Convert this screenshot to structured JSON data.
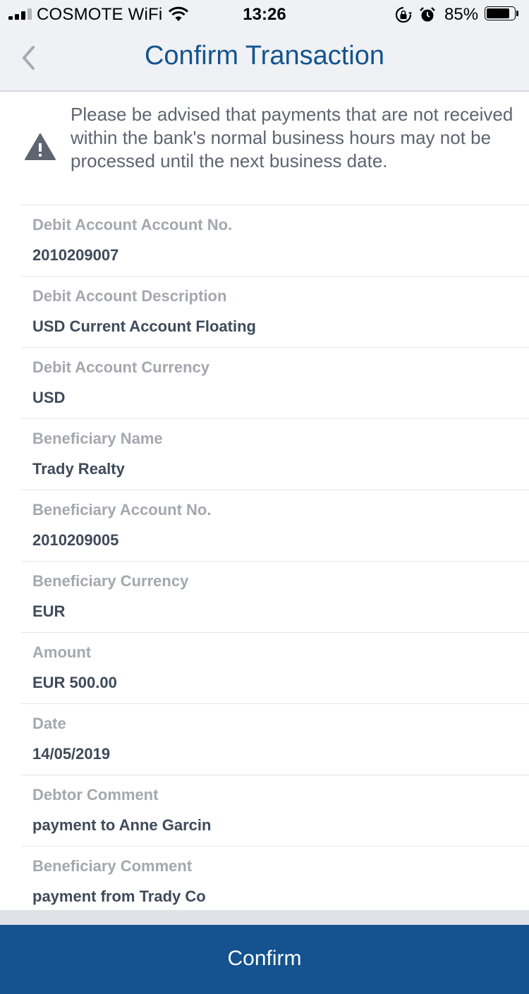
{
  "status_bar": {
    "carrier": "COSMOTE WiFi",
    "time": "13:26",
    "battery": "85%",
    "battery_level": 0.85,
    "signal_bars_active": 3,
    "signal_bars_total": 4,
    "icons": [
      "wifi-icon",
      "rotation-lock-icon",
      "alarm-icon",
      "battery-icon"
    ]
  },
  "header": {
    "title": "Confirm Transaction",
    "back_icon": "chevron-left-icon"
  },
  "notice": {
    "icon": "warning-icon",
    "text": "Please be advised that payments that are not received within the bank's normal business hours may not be processed until the next business date."
  },
  "details": [
    {
      "label": "Debit Account Account No.",
      "value": "2010209007"
    },
    {
      "label": "Debit Account Description",
      "value": "USD Current Account Floating"
    },
    {
      "label": "Debit Account Currency",
      "value": "USD"
    },
    {
      "label": "Beneficiary Name",
      "value": "Trady Realty"
    },
    {
      "label": "Beneficiary Account No.",
      "value": "2010209005"
    },
    {
      "label": "Beneficiary Currency",
      "value": "EUR"
    },
    {
      "label": "Amount",
      "value": "EUR 500.00"
    },
    {
      "label": "Date",
      "value": "14/05/2019"
    },
    {
      "label": "Debtor Comment",
      "value": "payment to Anne Garcin"
    },
    {
      "label": "Beneficiary Comment",
      "value": "payment from Trady Co"
    }
  ],
  "footer": {
    "confirm_label": "Confirm"
  },
  "colors": {
    "brand": "#14538e",
    "label": "#a4a8ae",
    "value": "#3f4a5a",
    "header_bg": "#eff1f4"
  }
}
